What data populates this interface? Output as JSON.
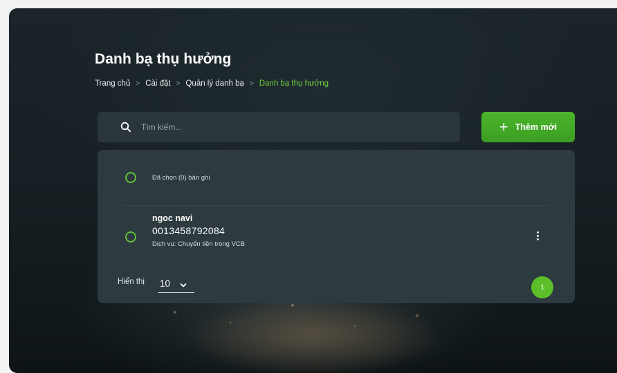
{
  "header": {
    "title": "Danh bạ thụ hưởng"
  },
  "breadcrumb": {
    "items": [
      "Trang chủ",
      "Cài đặt",
      "Quản lý danh bạ"
    ],
    "current": "Danh bạ thụ hưởng",
    "separator": ">"
  },
  "search": {
    "placeholder": "Tìm kiếm...",
    "value": ""
  },
  "toolbar": {
    "add_label": "Thêm mới",
    "add_icon": "+"
  },
  "list": {
    "selected_label": "Đã chọn (0) bản ghi",
    "items": [
      {
        "name": "ngoc navi",
        "account": "0013458792084",
        "service": "Dịch vụ: Chuyển tiền trong VCB"
      }
    ]
  },
  "pagination": {
    "page_size_label": "Hiển thị",
    "page_size": "10",
    "current_page": "1"
  },
  "colors": {
    "accent": "#4bb42c",
    "panel": "#2d3a3f",
    "search_bg": "#2a363b",
    "current_breadcrumb": "#6fcf3c"
  }
}
